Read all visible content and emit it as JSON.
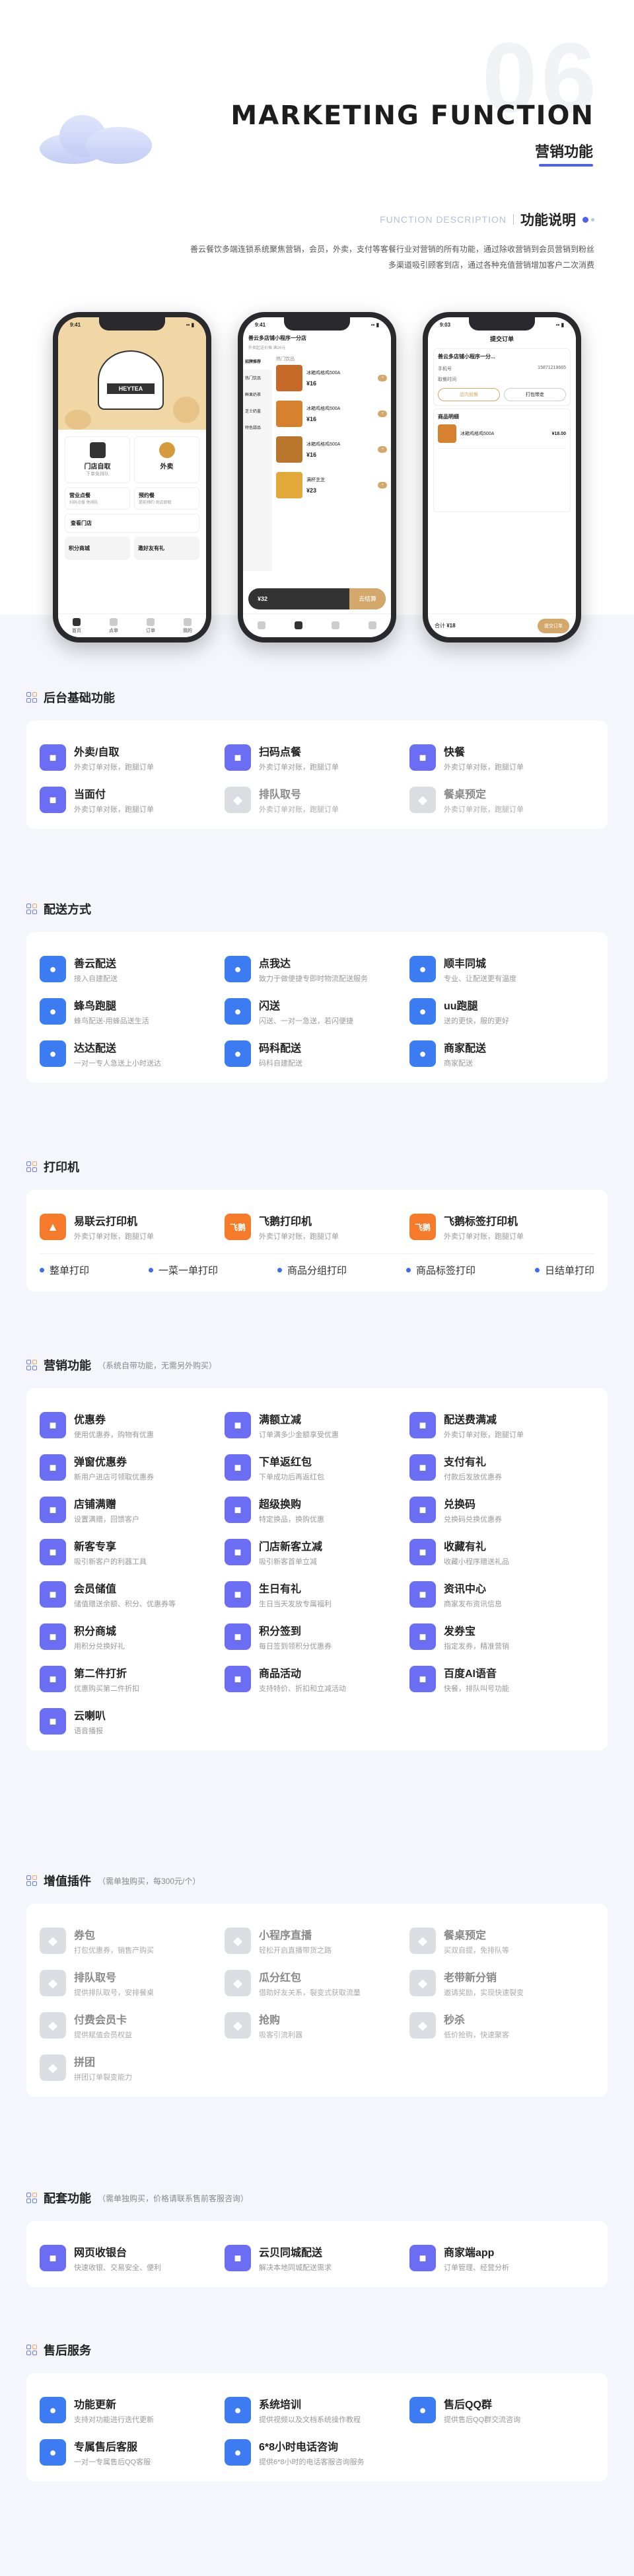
{
  "header": {
    "big_number": "06",
    "title_en": "MARKETING FUNCTION",
    "title_cn": "营销功能",
    "desc_en": "FUNCTION DESCRIPTION",
    "desc_cn": "功能说明",
    "intro_line1": "善云餐饮多端连锁系统聚焦营销，会员，外卖，支付等客餐行业对营销的所有功能，通过除收营销到会员营销到粉丝",
    "intro_line2": "多渠道吸引顾客到店，通过各种充值营销增加客户二次消费",
    "accent_color": "#4f63e8"
  },
  "phones": {
    "p1": {
      "status_time": "9:41",
      "banner_brand": "HEYTEA",
      "tile1_title": "门店自取",
      "tile1_sub": "下单免排队",
      "tile2_title": "外卖",
      "tile2_sub": "",
      "row1_a": "营业点餐",
      "row1_a_sub": "扫码点餐 免排队",
      "row1_b": "预约餐",
      "row1_b_sub": "提前预约 到店即取",
      "row2_a": "查看门店",
      "row3_a": "积分商城",
      "row3_b": "邀好友有礼",
      "tabs": [
        "首页",
        "点单",
        "订单",
        "我的"
      ]
    },
    "p2": {
      "store_name": "善云多店铺小程序一分店",
      "notice": "外卖起送价格 满26元",
      "categories": [
        "招牌推荐",
        "热门饮品",
        "鲜果奶茶",
        "芝士奶盖",
        "特色甜品"
      ],
      "group_title": "热门饮品",
      "items": [
        {
          "name": "冰箱鸡格鸡500A",
          "price": "¥16"
        },
        {
          "name": "冰箱鸡格鸡500A",
          "price": "¥16"
        },
        {
          "name": "冰箱鸡格鸡500A",
          "price": "¥16"
        },
        {
          "name": "满杯芝芝",
          "price": "¥23"
        }
      ],
      "cart_total": "¥32",
      "checkout": "去结算"
    },
    "p3": {
      "status_time": "9:03",
      "title": "提交订单",
      "store_name": "善云多店铺小程序一分...",
      "address_label": "收货人",
      "phone_label": "手机号",
      "phone_value": "15871219665",
      "pickup_label": "取餐时间",
      "opt1": "店内就餐",
      "opt2": "打包带走",
      "goods_label": "商品明细",
      "good_name": "冰箱鸡格鸡500A",
      "good_price": "¥18.00",
      "sum_label": "合计",
      "sum_value": "¥18",
      "pay": "提交订单"
    }
  },
  "sections": [
    {
      "title": "后台基础功能",
      "note": "",
      "items": [
        {
          "t": "外卖/自取",
          "d": "外卖订单对账，跑腿订单",
          "icon": "bike-icon",
          "color": "p"
        },
        {
          "t": "扫码点餐",
          "d": "外卖订单对账，跑腿订单",
          "icon": "scan-icon",
          "color": "p"
        },
        {
          "t": "快餐",
          "d": "外卖订单对账，跑腿订单",
          "icon": "bowl-icon",
          "color": "p"
        },
        {
          "t": "当面付",
          "d": "外卖订单对账，跑腿订单",
          "icon": "pay-icon",
          "color": "p"
        },
        {
          "t": "排队取号",
          "d": "外卖订单对账，跑腿订单",
          "icon": "queue-icon",
          "color": "g",
          "dim": true
        },
        {
          "t": "餐桌预定",
          "d": "外卖订单对账，跑腿订单",
          "icon": "table-icon",
          "color": "g",
          "dim": true
        }
      ]
    },
    {
      "title": "配送方式",
      "note": "",
      "items": [
        {
          "t": "善云配送",
          "d": "接入自建配送",
          "icon": "deliver-icon",
          "color": "b"
        },
        {
          "t": "点我达",
          "d": "致力于做便捷专即时物流配送服务",
          "icon": "dianwoda-icon",
          "color": "b"
        },
        {
          "t": "顺丰同城",
          "d": "专业、让配送更有温度",
          "icon": "sf-icon",
          "color": "b"
        },
        {
          "t": "蜂鸟跑腿",
          "d": "蜂鸟配送-用蜂品送生活",
          "icon": "bird-icon",
          "color": "b"
        },
        {
          "t": "闪送",
          "d": "闪送、一对一急送，若闪便捷",
          "icon": "flash-icon",
          "color": "b"
        },
        {
          "t": "uu跑腿",
          "d": "送的更快，服的更好",
          "icon": "uu-icon",
          "color": "b"
        },
        {
          "t": "达达配送",
          "d": "一对一专人急送上小时送达",
          "icon": "dada-icon",
          "color": "b"
        },
        {
          "t": "码科配送",
          "d": "码科自建配送",
          "icon": "maker-icon",
          "color": "b"
        },
        {
          "t": "商家配送",
          "d": "商家配送",
          "icon": "shop-icon",
          "color": "b"
        }
      ]
    },
    {
      "title": "打印机",
      "note": "",
      "items": [
        {
          "t": "易联云打印机",
          "d": "外卖订单对账，跑腿订单",
          "icon": "cloud-print-icon",
          "color": "o"
        },
        {
          "t": "飞鹅打印机",
          "d": "外卖订单对账，跑腿订单",
          "icon": "feie-icon",
          "color": "o",
          "badge": "飞鹅"
        },
        {
          "t": "飞鹅标签打印机",
          "d": "外卖订单对账，跑腿订单",
          "icon": "feie-label-icon",
          "color": "o",
          "badge": "飞鹅"
        }
      ],
      "print_options": [
        "整单打印",
        "一菜一单打印",
        "商品分组打印",
        "商品标签打印",
        "日结单打印"
      ]
    },
    {
      "title": "营销功能",
      "note": "（系统自带功能，无需另外购买）",
      "items": [
        {
          "t": "优惠券",
          "d": "使用优惠券，购物有优惠",
          "icon": "coupon-icon",
          "color": "p"
        },
        {
          "t": "满额立减",
          "d": "订单满多少金额享受优惠",
          "icon": "discount-icon",
          "color": "p"
        },
        {
          "t": "配送费满减",
          "d": "外卖订单对账，跑腿订单",
          "icon": "fee-icon",
          "color": "p"
        },
        {
          "t": "弹窗优惠券",
          "d": "新用户进店可领取优惠券",
          "icon": "popup-coupon-icon",
          "color": "p"
        },
        {
          "t": "下单返红包",
          "d": "下单成功后再返红包",
          "icon": "redpack-icon",
          "color": "p"
        },
        {
          "t": "支付有礼",
          "d": "付款后发放优惠券",
          "icon": "gift-icon",
          "color": "p"
        },
        {
          "t": "店铺满赠",
          "d": "设置满赠，回馈客户",
          "icon": "shop-gift-icon",
          "color": "p"
        },
        {
          "t": "超级换购",
          "d": "特定换品，换购优惠",
          "icon": "exchange-icon",
          "color": "p"
        },
        {
          "t": "兑换码",
          "d": "兑换码兑换优惠券",
          "icon": "code-icon",
          "color": "p"
        },
        {
          "t": "新客专享",
          "d": "吸引新客户的利器工具",
          "icon": "newuser-icon",
          "color": "p"
        },
        {
          "t": "门店新客立减",
          "d": "吸引新客首单立减",
          "icon": "store-new-icon",
          "color": "p"
        },
        {
          "t": "收藏有礼",
          "d": "收藏小程序赠送礼品",
          "icon": "star-icon",
          "color": "p"
        },
        {
          "t": "会员储值",
          "d": "储值赠送余额、积分、优惠券等",
          "icon": "vip-icon",
          "color": "p"
        },
        {
          "t": "生日有礼",
          "d": "生日当天发放专属福利",
          "icon": "cake-icon",
          "color": "p"
        },
        {
          "t": "资讯中心",
          "d": "商家发布资讯信息",
          "icon": "news-icon",
          "color": "p"
        },
        {
          "t": "积分商城",
          "d": "用积分兑换好礼",
          "icon": "points-mall-icon",
          "color": "p"
        },
        {
          "t": "积分签到",
          "d": "每日签到领积分优惠券",
          "icon": "checkin-icon",
          "color": "p"
        },
        {
          "t": "发券宝",
          "d": "指定发券，精准营销",
          "icon": "send-coupon-icon",
          "color": "p"
        },
        {
          "t": "第二件打折",
          "d": "优惠购买第二件折扣",
          "icon": "tag-icon",
          "color": "p"
        },
        {
          "t": "商品活动",
          "d": "支持特价、折扣和立减活动",
          "icon": "activity-icon",
          "color": "p"
        },
        {
          "t": "百度AI语音",
          "d": "快餐，排队叫号功能",
          "icon": "voice-icon",
          "color": "p"
        },
        {
          "t": "云喇叭",
          "d": "语音播报",
          "icon": "speaker-icon",
          "color": "p"
        }
      ]
    },
    {
      "title": "增值插件",
      "note": "（需单独购买，每300元/个）",
      "items": [
        {
          "t": "券包",
          "d": "打包优惠券，销售产购买",
          "icon": "coupon-pack-icon",
          "color": "g",
          "dim": true
        },
        {
          "t": "小程序直播",
          "d": "轻松开启直播带货之路",
          "icon": "live-icon",
          "color": "g",
          "dim": true
        },
        {
          "t": "餐桌预定",
          "d": "买双自提，免排队等",
          "icon": "reserve-icon",
          "color": "g",
          "dim": true
        },
        {
          "t": "排队取号",
          "d": "提供排队取号，安排餐桌",
          "icon": "queue2-icon",
          "color": "g",
          "dim": true
        },
        {
          "t": "瓜分红包",
          "d": "借助好友关系，裂变式获取流量",
          "icon": "split-redpack-icon",
          "color": "g",
          "dim": true
        },
        {
          "t": "老带新分销",
          "d": "邀请奖励，实现快速裂变",
          "icon": "share-icon",
          "color": "g",
          "dim": true
        },
        {
          "t": "付费会员卡",
          "d": "提供赋值会员权益",
          "icon": "card-icon",
          "color": "g",
          "dim": true
        },
        {
          "t": "抢购",
          "d": "吸客引流利器",
          "icon": "flashsale-icon",
          "color": "g",
          "dim": true
        },
        {
          "t": "秒杀",
          "d": "低价抢购，快速聚客",
          "icon": "seckill-icon",
          "color": "g",
          "dim": true
        },
        {
          "t": "拼团",
          "d": "拼团订单裂变能力",
          "icon": "group-icon",
          "color": "g",
          "dim": true
        }
      ]
    },
    {
      "title": "配套功能",
      "note": "（需单独购买，价格请联系售前客服咨询）",
      "items": [
        {
          "t": "网页收银台",
          "d": "快速收银、交易安全、便利",
          "icon": "cashier-icon",
          "color": "p"
        },
        {
          "t": "云贝同城配送",
          "d": "解决本地同城配送需求",
          "icon": "city-deliver-icon",
          "color": "p"
        },
        {
          "t": "商家端app",
          "d": "订单管理、经营分析",
          "icon": "app-icon",
          "color": "p"
        }
      ]
    },
    {
      "title": "售后服务",
      "note": "",
      "items": [
        {
          "t": "功能更新",
          "d": "支持对功能进行迭代更新",
          "icon": "update-icon",
          "color": "b"
        },
        {
          "t": "系统培训",
          "d": "提供视频以及文档系统操作教程",
          "icon": "training-icon",
          "color": "b"
        },
        {
          "t": "售后QQ群",
          "d": "提供售后QQ群交流咨询",
          "icon": "qq-group-icon",
          "color": "b"
        },
        {
          "t": "专属售后客服",
          "d": "一对一专属售后QQ客服",
          "icon": "service-icon",
          "color": "b"
        },
        {
          "t": "6*8小时电话咨询",
          "d": "提供6*8小时的电话客服咨询服务",
          "icon": "phone-icon",
          "color": "b"
        }
      ]
    }
  ]
}
